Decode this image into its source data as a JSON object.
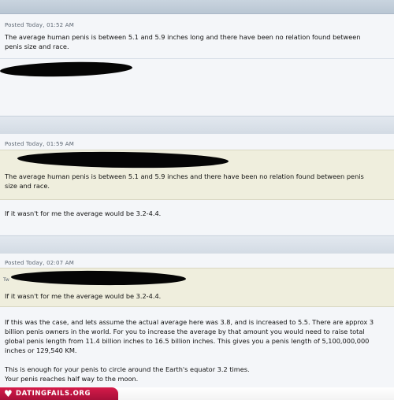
{
  "posts": [
    {
      "meta": "Posted Today, 01:52 AM",
      "body_lines": [
        "The average human penis is between 5.1 and 5.9 inches long and there have been no relation found between",
        "penis size and race."
      ]
    },
    {
      "meta": "Posted Today, 01:59 AM",
      "quote_lines": [
        "The average human penis is between 5.1 and 5.9 inches and there have been no relation found between penis",
        "size and race."
      ],
      "body": "If it wasn't for me the average would be 3.2-4.4."
    },
    {
      "meta": "Posted Today, 02:07 AM",
      "quote_prefix": "Tw",
      "quote": "If it wasn't for me the average would be 3.2-4.4.",
      "para1_lines": [
        "If this was the case, and lets assume the actual average here was 3.8, and is increased to 5.5. There are approx 3",
        "billion penis owners in the world. For you to increase the average by that amount you would need to raise total",
        "global penis length from 11.4 billion inches to 16.5 billion inches. This gives you a penis length of 5,100,000,000",
        "inches or 129,540 KM."
      ],
      "para2_lines": [
        "This is enough for your penis to circle around the Earth's equator 3.2 times.",
        "Your penis reaches half way to the moon."
      ]
    }
  ],
  "footer": {
    "logo_text": "DATINGFAILS.ORG",
    "brand_color": "#c4163f"
  }
}
